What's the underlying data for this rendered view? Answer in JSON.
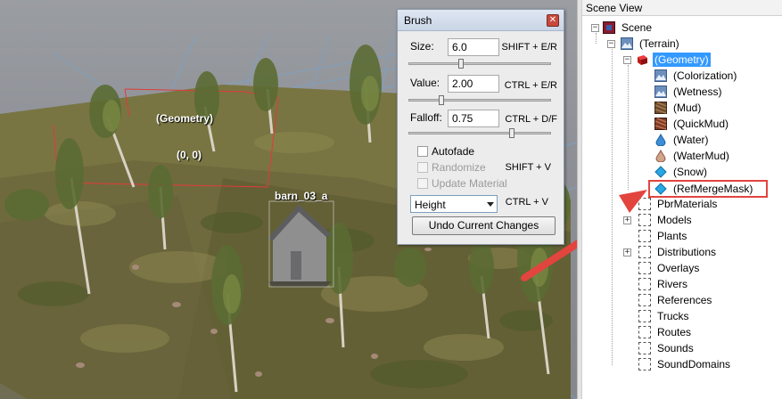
{
  "viewport": {
    "labels": {
      "geometry": "(Geometry)",
      "origin": "(0, 0)",
      "barn": "barn_03_a"
    }
  },
  "brush": {
    "title": "Brush",
    "size_label": "Size:",
    "size_value": "6.0",
    "size_shortcut": "SHIFT + E/R",
    "size_level": 0.36,
    "value_label": "Value:",
    "value_value": "2.00",
    "value_shortcut": "CTRL + E/R",
    "value_level": 0.22,
    "falloff_label": "Falloff:",
    "falloff_value": "0.75",
    "falloff_shortcut": "CTRL + D/F",
    "falloff_level": 0.74,
    "autofade_label": "Autofade",
    "randomize_label": "Randomize",
    "randomize_shortcut": "SHIFT + V",
    "update_material_label": "Update Material",
    "mode_value": "Height",
    "mode_shortcut": "CTRL + V",
    "undo_label": "Undo Current Changes"
  },
  "scene_view": {
    "title": "Scene View",
    "root": "Scene",
    "terrain": "(Terrain)",
    "geometry": "(Geometry)",
    "geometry_children": [
      "(Colorization)",
      "(Wetness)",
      "(Mud)",
      "(QuickMud)",
      "(Water)",
      "(WaterMud)",
      "(Snow)",
      "(RefMergeMask)"
    ],
    "terrain_children": [
      "PbrMaterials",
      "Models",
      "Plants",
      "Distributions",
      "Overlays",
      "Rivers",
      "References",
      "Trucks",
      "Routes",
      "Sounds",
      "SoundDomains"
    ]
  },
  "colors": {
    "selection": "#3399ff",
    "highlight": "#e2443e",
    "arrow": "#e2443e"
  }
}
